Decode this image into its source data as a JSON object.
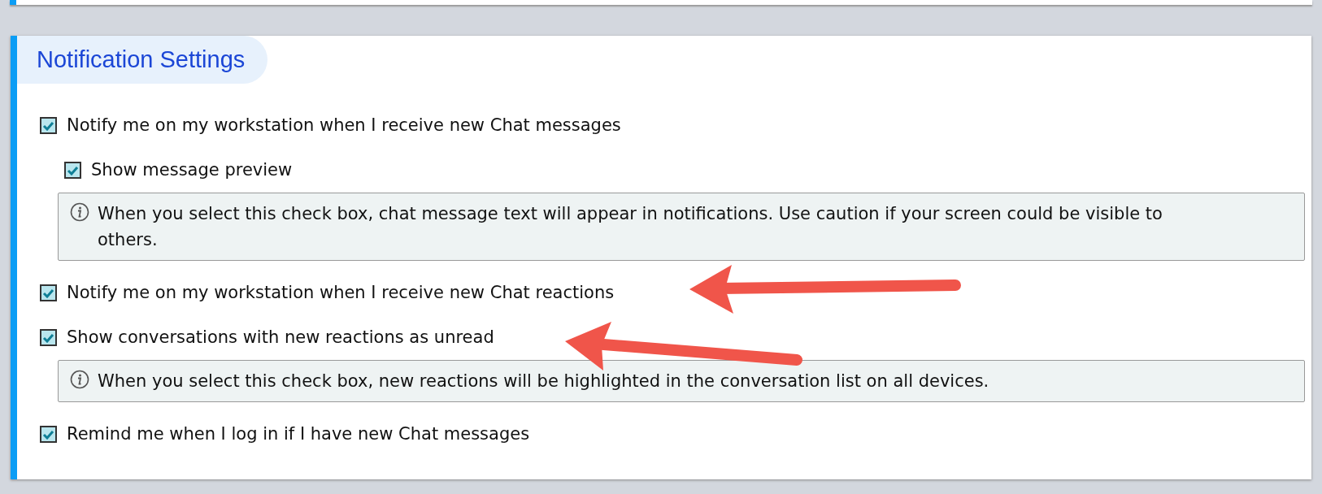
{
  "section": {
    "title": "Notification Settings"
  },
  "items": [
    {
      "kind": "checkbox",
      "label": "Notify me on my workstation when I receive new Chat messages",
      "checked": true,
      "children": [
        {
          "kind": "checkbox",
          "label": "Show message preview",
          "checked": true
        },
        {
          "kind": "info",
          "text": "When you select this check box, chat message text will appear in notifications. Use caution if your screen could be visible to others."
        }
      ]
    },
    {
      "kind": "checkbox",
      "label": "Notify me on my workstation when I receive new Chat reactions",
      "checked": true
    },
    {
      "kind": "checkbox",
      "label": "Show conversations with new reactions as unread",
      "checked": true,
      "children": [
        {
          "kind": "info",
          "text": "When you select this check box, new reactions will be highlighted in the conversation list on all devices."
        }
      ]
    },
    {
      "kind": "checkbox",
      "label": "Remind me when I log in if I have new Chat messages",
      "checked": true
    }
  ]
}
